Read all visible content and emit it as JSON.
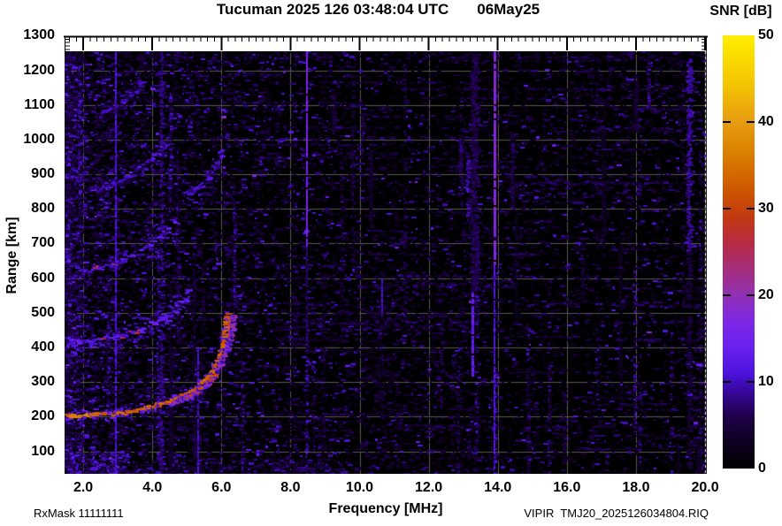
{
  "annotations": {
    "rxmask": "RxMask 11111111",
    "file_id": "VIPIR  TMJ20_2025126034804.RIQ"
  },
  "chart_data": {
    "type": "heatmap",
    "title": "Tucuman 2025 126 03:48:04 UTC",
    "date_label": "06May25",
    "xlabel": "Frequency [MHz]",
    "ylabel": "Range [km]",
    "colorbar_label": "SNR [dB]",
    "x_range_mhz": [
      1.46,
      20.05
    ],
    "y_range_km": [
      35,
      1255
    ],
    "x_ticks": [
      "2.0",
      "4.0",
      "6.0",
      "8.0",
      "10.0",
      "12.0",
      "14.0",
      "16.0",
      "18.0",
      "20.0"
    ],
    "y_ticks": [
      1300,
      1200,
      1100,
      1000,
      900,
      800,
      700,
      600,
      500,
      400,
      300,
      200,
      100
    ],
    "grid": true,
    "colorbar_range": [
      0,
      50
    ],
    "colorbar_ticks": [
      0,
      10,
      20,
      30,
      40,
      50
    ],
    "colorbar_inner_ticks": [
      10,
      20,
      30,
      40
    ],
    "palette_stops": [
      [
        0,
        "#000000"
      ],
      [
        3,
        "#0e0020"
      ],
      [
        6,
        "#1e0048"
      ],
      [
        9,
        "#38089e"
      ],
      [
        11,
        "#4c13dc"
      ],
      [
        14,
        "#6a20ee"
      ],
      [
        17,
        "#7d28e4"
      ],
      [
        20,
        "#9130b4"
      ],
      [
        23,
        "#a52e7a"
      ],
      [
        26,
        "#b72b44"
      ],
      [
        29,
        "#c33912"
      ],
      [
        32,
        "#cc5500"
      ],
      [
        36,
        "#d97d00"
      ],
      [
        40,
        "#e69c10"
      ],
      [
        45,
        "#f6ca00"
      ],
      [
        50,
        "#ffee00"
      ]
    ],
    "grid_color": "#585858",
    "traces": [
      {
        "name": "F-echo-O-mode",
        "w0": 15,
        "w1": 9,
        "core_db": 33,
        "density": 0.95,
        "halo_db": 12,
        "hot": {
          "f0": 1.46,
          "f1": 2.4,
          "db": 36,
          "p": 0.7
        },
        "points": [
          [
            1.5,
            206
          ],
          [
            2.0,
            206
          ],
          [
            2.4,
            208
          ],
          [
            2.8,
            211
          ],
          [
            3.2,
            216
          ],
          [
            3.6,
            223
          ],
          [
            4.0,
            232
          ],
          [
            4.4,
            244
          ],
          [
            4.8,
            260
          ],
          [
            5.1,
            276
          ],
          [
            5.4,
            298
          ],
          [
            5.65,
            325
          ],
          [
            5.85,
            360
          ],
          [
            5.98,
            400
          ],
          [
            6.06,
            445
          ],
          [
            6.12,
            500
          ]
        ]
      },
      {
        "name": "F-echo-X-mode",
        "w0": 9,
        "w1": 8,
        "core_db": 20,
        "density": 0.8,
        "halo_db": 11,
        "hot": {
          "f0": 4.8,
          "f1": 5.8,
          "db": 30,
          "p": 0.45
        },
        "points": [
          [
            4.5,
            238
          ],
          [
            4.9,
            252
          ],
          [
            5.2,
            268
          ],
          [
            5.5,
            290
          ],
          [
            5.75,
            318
          ],
          [
            5.95,
            352
          ],
          [
            6.12,
            396
          ],
          [
            6.25,
            448
          ],
          [
            6.33,
            500
          ]
        ]
      },
      {
        "name": "multiple-2F",
        "w0": 16,
        "w1": 42,
        "core_db": 12,
        "density": 0.55,
        "halo_db": 9,
        "hot": {
          "f0": 2.3,
          "f1": 3.6,
          "db": 27,
          "p": 0.22
        },
        "points": [
          [
            1.5,
            413
          ],
          [
            2.0,
            417
          ],
          [
            2.5,
            424
          ],
          [
            3.0,
            434
          ],
          [
            3.5,
            448
          ],
          [
            3.9,
            464
          ],
          [
            4.3,
            486
          ],
          [
            4.6,
            508
          ],
          [
            4.9,
            538
          ],
          [
            5.05,
            560
          ]
        ]
      },
      {
        "name": "multiple-2F-cusp",
        "w0": 14,
        "w1": 12,
        "core_db": 11,
        "density": 0.4,
        "halo_db": 8,
        "points": [
          [
            4.95,
            845
          ],
          [
            5.3,
            862
          ],
          [
            5.6,
            888
          ],
          [
            5.85,
            925
          ],
          [
            6.0,
            975
          ]
        ]
      },
      {
        "name": "multiple-3F",
        "w0": 14,
        "w1": 36,
        "core_db": 11.5,
        "density": 0.5,
        "halo_db": 8,
        "hot": {
          "f0": 2.1,
          "f1": 3.1,
          "db": 25,
          "p": 0.18
        },
        "points": [
          [
            1.9,
            620
          ],
          [
            2.4,
            630
          ],
          [
            2.9,
            645
          ],
          [
            3.4,
            668
          ],
          [
            3.9,
            700
          ],
          [
            4.35,
            738
          ],
          [
            4.75,
            780
          ]
        ]
      },
      {
        "name": "multiple-4F",
        "w0": 13,
        "w1": 30,
        "core_db": 10.5,
        "density": 0.45,
        "halo_db": 7,
        "hot": {
          "f0": 3.3,
          "f1": 3.6,
          "db": 16,
          "p": 0.35
        },
        "points": [
          [
            2.15,
            848
          ],
          [
            2.6,
            860
          ],
          [
            3.0,
            880
          ],
          [
            3.4,
            906
          ],
          [
            3.8,
            938
          ],
          [
            4.2,
            968
          ],
          [
            4.5,
            995
          ]
        ]
      },
      {
        "name": "multiple-5F",
        "w0": 12,
        "w1": 24,
        "core_db": 9.5,
        "density": 0.4,
        "halo_db": 7,
        "points": [
          [
            2.4,
            1072
          ],
          [
            2.8,
            1092
          ],
          [
            3.2,
            1118
          ],
          [
            3.5,
            1142
          ],
          [
            3.72,
            1165
          ]
        ]
      }
    ],
    "rfi_stripes": [
      {
        "f": 8.49,
        "w": 2,
        "db": 16,
        "r0": 690,
        "r1": 1255,
        "mode": "solid"
      },
      {
        "f": 8.49,
        "w": 2,
        "db": 7,
        "r0": 420,
        "r1": 690,
        "mode": "solid"
      },
      {
        "f": 13.93,
        "w": 3,
        "db": 18,
        "r0": 640,
        "r1": 1255,
        "mode": "solid"
      },
      {
        "f": 13.93,
        "w": 2,
        "db": 11,
        "r0": 35,
        "r1": 640,
        "mode": "solid"
      },
      {
        "f": 13.28,
        "w": 3,
        "db": 13,
        "r0": 315,
        "r1": 560,
        "mode": "solid"
      },
      {
        "f": 13.3,
        "w": 10,
        "db": 6,
        "r0": 560,
        "r1": 1255,
        "mode": "diffuse"
      },
      {
        "f": 19.52,
        "w": 6,
        "db": 9,
        "r0": 680,
        "r1": 1240,
        "mode": "diffuse"
      },
      {
        "f": 19.52,
        "w": 4,
        "db": 5,
        "r0": 35,
        "r1": 680,
        "mode": "diffuse"
      },
      {
        "f": 5.33,
        "w": 2,
        "db": 10,
        "r0": 35,
        "r1": 400,
        "mode": "solid"
      },
      {
        "f": 2.95,
        "w": 2,
        "db": 11,
        "r0": 35,
        "r1": 1255,
        "mode": "solid"
      },
      {
        "f": 4.24,
        "w": 3,
        "db": 8,
        "r0": 35,
        "r1": 1255,
        "mode": "diffuse"
      },
      {
        "f": 10.66,
        "w": 2,
        "db": 10,
        "r0": 490,
        "r1": 600,
        "mode": "solid"
      }
    ],
    "noise_regions": [
      {
        "f0": 1.46,
        "f1": 1.82,
        "r0": 35,
        "r1": 1255,
        "d": 0.65,
        "db0": 4,
        "db1": 16
      },
      {
        "f0": 1.82,
        "f1": 2.95,
        "r0": 35,
        "r1": 1255,
        "d": 0.22,
        "db0": 3,
        "db1": 14
      },
      {
        "f0": 2.95,
        "f1": 5.3,
        "r0": 35,
        "r1": 1255,
        "d": 0.11,
        "db0": 3,
        "db1": 13
      },
      {
        "f0": 5.3,
        "f1": 20.05,
        "r0": 35,
        "r1": 1255,
        "d": 0.05,
        "db0": 2,
        "db1": 10
      },
      {
        "f0": 1.46,
        "f1": 3.3,
        "r0": 35,
        "r1": 100,
        "d": 0.7,
        "db0": 6,
        "db1": 16
      },
      {
        "f0": 3.3,
        "f1": 9.7,
        "r0": 35,
        "r1": 80,
        "d": 0.32,
        "db0": 4,
        "db1": 13
      },
      {
        "f0": 9.9,
        "f1": 12.4,
        "r0": 35,
        "r1": 620,
        "d": 0.16,
        "db0": 3,
        "db1": 10
      },
      {
        "f0": 16.2,
        "f1": 19.4,
        "r0": 1020,
        "r1": 1240,
        "d": 0.1,
        "db0": 3,
        "db1": 9
      },
      {
        "f0": 1.46,
        "f1": 20.05,
        "r0": 1225,
        "r1": 1255,
        "d": 0.2,
        "db0": 3,
        "db1": 10
      },
      {
        "f0": 1.8,
        "f1": 5.6,
        "r0": 230,
        "r1": 420,
        "d": 0.08,
        "db0": 3,
        "db1": 10
      },
      {
        "f0": 12.6,
        "f1": 13.6,
        "r0": 35,
        "r1": 620,
        "d": 0.12,
        "db0": 3,
        "db1": 9
      }
    ],
    "noise": {
      "seed": 20250506,
      "base_dashes": 9000,
      "columns": 80,
      "rows": 140
    }
  }
}
